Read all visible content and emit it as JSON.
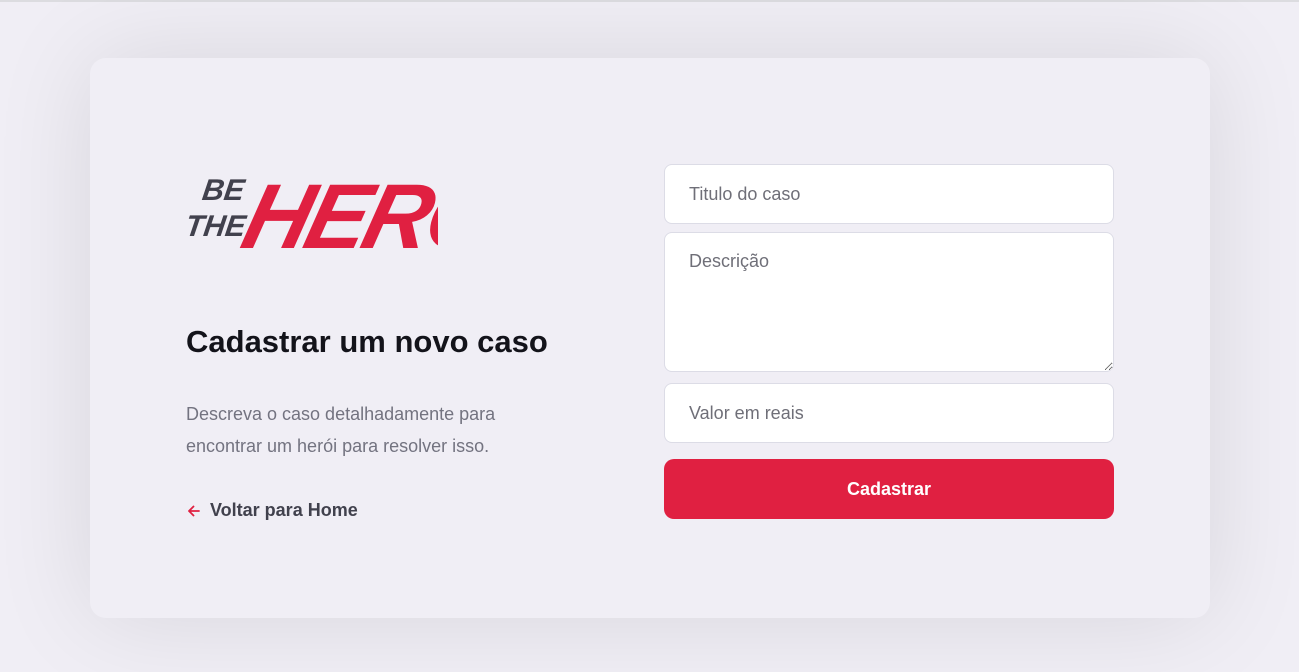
{
  "app": {
    "logo_text": "BE THE HERO",
    "accent_color": "#e02041",
    "logo_dark_color": "#41414d"
  },
  "page": {
    "title": "Cadastrar um novo caso",
    "description": "Descreva o caso detalhadamente para encontrar um herói para resolver isso.",
    "back_link": {
      "label": "Voltar para Home",
      "icon": "arrow-left-icon"
    }
  },
  "form": {
    "title_field": {
      "placeholder": "Titulo do caso",
      "value": ""
    },
    "description_field": {
      "placeholder": "Descrição",
      "value": ""
    },
    "value_field": {
      "placeholder": "Valor em reais",
      "value": ""
    },
    "submit_label": "Cadastrar"
  }
}
